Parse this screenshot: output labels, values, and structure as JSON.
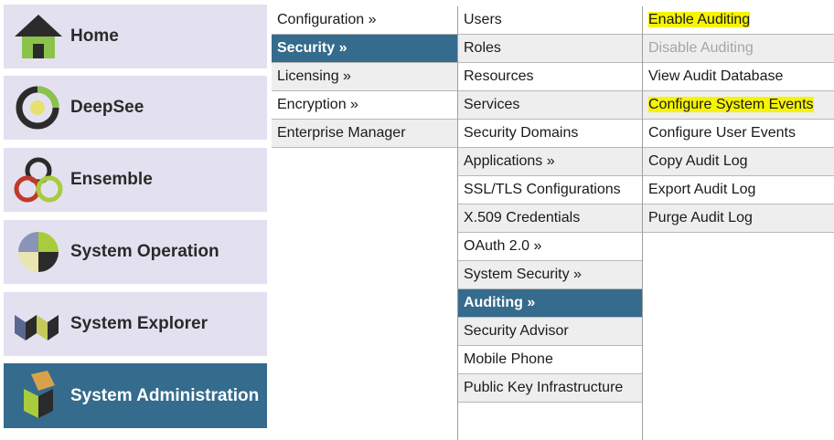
{
  "nav": {
    "home": "Home",
    "deepsee": "DeepSee",
    "ensemble": "Ensemble",
    "system_operation": "System Operation",
    "system_explorer": "System Explorer",
    "system_administration": "System Administration"
  },
  "menu1": [
    "Configuration »",
    "Security »",
    "Licensing »",
    "Encryption »",
    "Enterprise Manager"
  ],
  "menu2": [
    "Users",
    "Roles",
    "Resources",
    "Services",
    "Security Domains",
    "Applications »",
    "SSL/TLS Configurations",
    "X.509 Credentials",
    "OAuth 2.0 »",
    "System Security »",
    "Auditing »",
    "Security Advisor",
    "Mobile Phone",
    "Public Key Infrastructure"
  ],
  "menu3": [
    "Enable Auditing",
    "Disable Auditing",
    "View Audit Database",
    "Configure System Events",
    "Configure User Events",
    "Copy Audit Log",
    "Export Audit Log",
    "Purge Audit Log"
  ],
  "colors": {
    "tile_bg": "#e3e1f0",
    "selected_bg": "#356b8c",
    "highlight": "#f6f400"
  },
  "icons": {
    "home": "house-icon",
    "deepsee": "deepsee-icon",
    "ensemble": "ensemble-rings-icon",
    "system_operation": "pie-quadrant-icon",
    "system_explorer": "zigzag-icon",
    "system_administration": "cube-icon"
  }
}
